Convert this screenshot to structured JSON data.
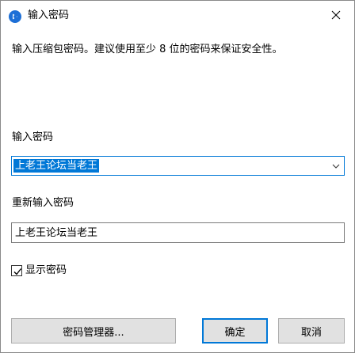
{
  "window": {
    "title": "输入密码",
    "icon": "app-logo-icon",
    "close_icon": "close-icon"
  },
  "dialog": {
    "description": "输入压缩包密码。建议使用至少 8 位的密码来保证安全性。",
    "password_label": "输入密码",
    "password_value": "上老王论坛当老王",
    "reenter_label": "重新输入密码",
    "reenter_value": "上老王论坛当老王",
    "show_password_label": "显示密码",
    "show_password_checked": true
  },
  "buttons": {
    "manager_label": "密码管理器...",
    "ok_label": "确定",
    "cancel_label": "取消"
  },
  "colors": {
    "accent": "#0078d7",
    "button_bg": "#e1e1e1",
    "button_border": "#adadad"
  }
}
